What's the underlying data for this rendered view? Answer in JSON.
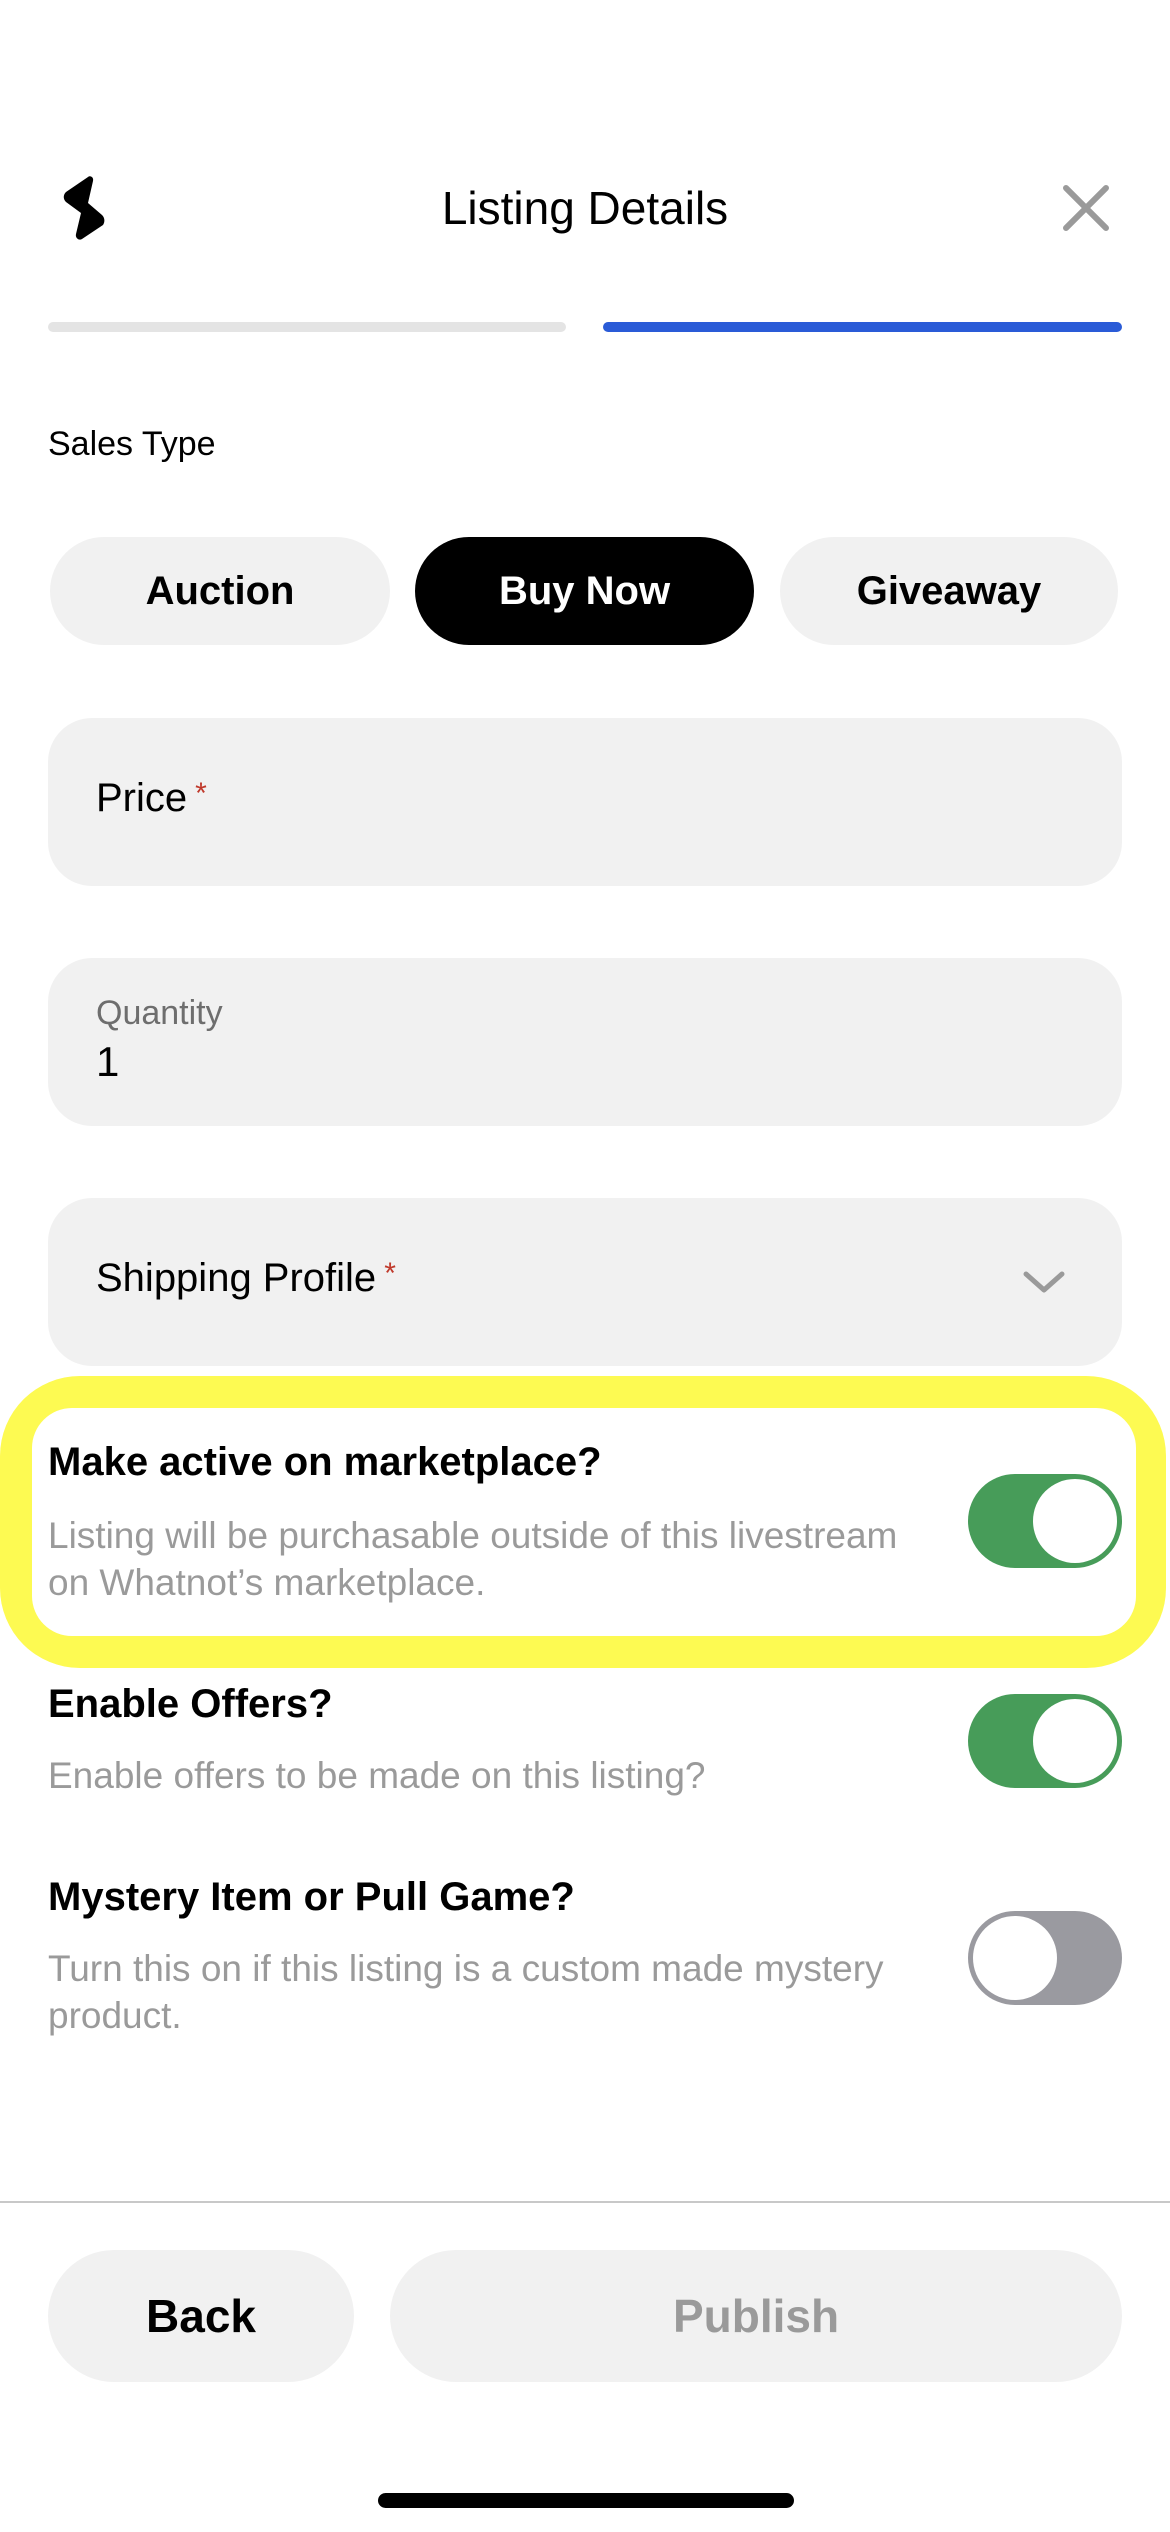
{
  "header": {
    "title": "Listing Details",
    "logo_icon": "lightning-bolt-icon",
    "close_icon": "close-icon"
  },
  "progress": {
    "steps_total": 2,
    "current_step": 2,
    "colors": {
      "active": "#2a5bd7",
      "inactive": "#e4e4e4"
    }
  },
  "sales_type": {
    "label": "Sales Type",
    "options": [
      {
        "label": "Auction",
        "selected": false
      },
      {
        "label": "Buy Now",
        "selected": true
      },
      {
        "label": "Giveaway",
        "selected": false
      }
    ]
  },
  "fields": {
    "price": {
      "label": "Price",
      "required_mark": "*",
      "value": ""
    },
    "quantity": {
      "label": "Quantity",
      "value": "1"
    },
    "shipping_profile": {
      "label": "Shipping Profile",
      "required_mark": "*",
      "value": ""
    }
  },
  "options": [
    {
      "title": "Make active on marketplace?",
      "description": "Listing will be purchasable outside of this livestream on Whatnot’s marketplace.",
      "enabled": true,
      "highlighted": true
    },
    {
      "title": "Enable Offers?",
      "description": "Enable offers to be made on this listing?",
      "enabled": true,
      "highlighted": false
    },
    {
      "title": "Mystery Item or Pull Game?",
      "description": "Turn this on if this listing is a custom made mystery product.",
      "enabled": false,
      "highlighted": false
    }
  ],
  "footer": {
    "back_label": "Back",
    "publish_label": "Publish",
    "publish_enabled": false
  },
  "colors": {
    "toggle_on": "#479c59",
    "toggle_off": "#9a9aa0",
    "highlight": "#fdfa52",
    "required": "#c0392b"
  }
}
